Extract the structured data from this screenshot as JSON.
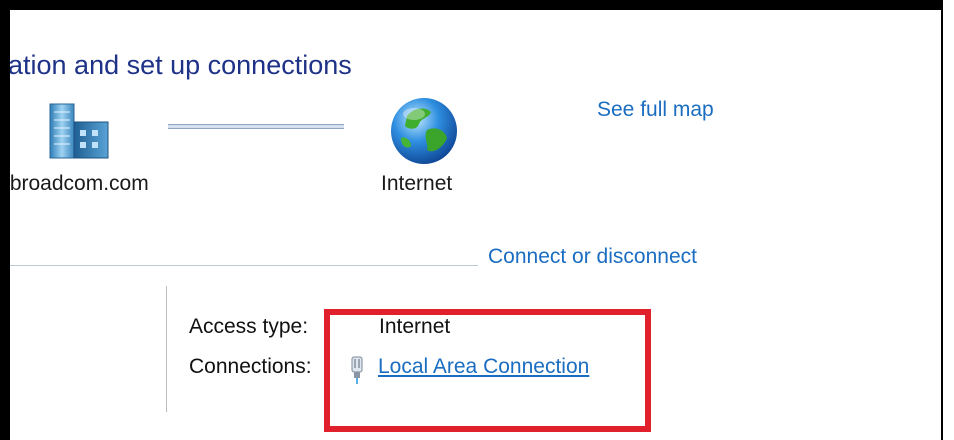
{
  "header": {
    "title": "ation and set up connections"
  },
  "network_map": {
    "domain_label": ".broadcom.com",
    "internet_label": "Internet",
    "see_full_map_link": "See full map",
    "icons": {
      "domain": "domain-server-icon",
      "internet": "globe-icon"
    }
  },
  "active_network": {
    "connect_link": "Connect or disconnect",
    "access_type_label": "Access type:",
    "access_type_value": "Internet",
    "connections_label": "Connections:",
    "connections_value": "Local Area Connection",
    "connection_icon": "ethernet-plug-icon"
  },
  "colors": {
    "title": "#1e3287",
    "link": "#1b6dc1",
    "highlight": "#e0212b"
  }
}
